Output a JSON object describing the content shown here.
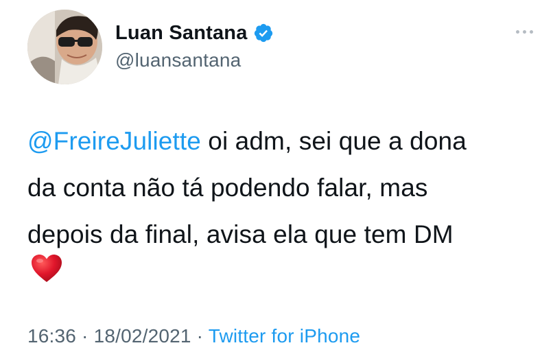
{
  "author": {
    "display_name": "Luan Santana",
    "handle": "@luansantana",
    "verified": true
  },
  "tweet": {
    "mention": "@FreireJuliette",
    "line1_rest": " oi adm, sei que a dona",
    "line2": "da conta não tá podendo falar, mas",
    "line3": "depois da final, avisa ela que tem DM",
    "emoji": "heart-emoji"
  },
  "meta": {
    "time": "16:36",
    "separator1": " · ",
    "date": "18/02/2021",
    "separator2": " · ",
    "source": "Twitter for iPhone"
  },
  "icons": {
    "verified": "verified-badge-icon",
    "more": "more-options-icon"
  },
  "colors": {
    "link": "#1d9bf0",
    "secondary_text": "#536471",
    "primary_text": "#0f1419",
    "heart": "#e0162b"
  }
}
